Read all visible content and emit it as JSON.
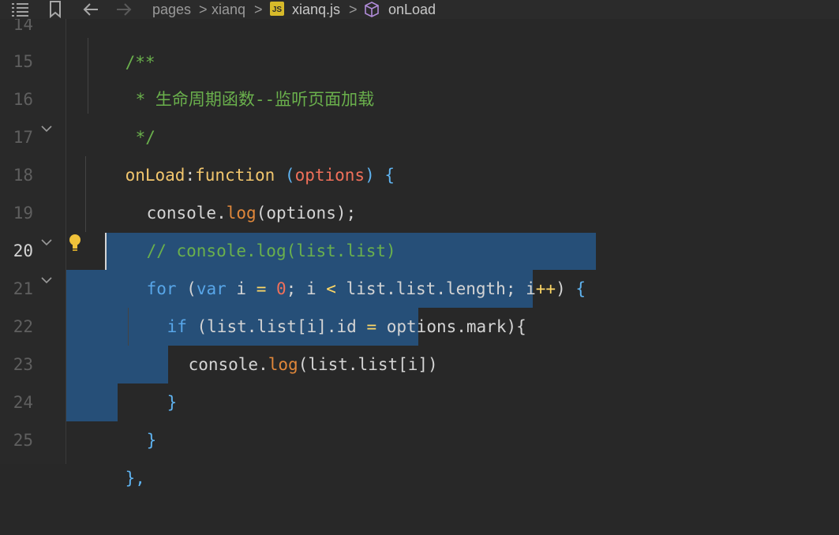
{
  "breadcrumb": {
    "items": [
      "pages",
      "xianq",
      "xianq.js",
      "onLoad"
    ],
    "file_badge": "JS",
    "separator": ">"
  },
  "gutter": {
    "line_numbers": [
      "14",
      "15",
      "16",
      "17",
      "18",
      "19",
      "20",
      "21",
      "22",
      "23",
      "24",
      "25"
    ],
    "active_line": "20"
  },
  "code": {
    "l14": "/**",
    "l15": "* 生命周期函数--监听页面加载",
    "l16": "*/",
    "l17_key": "onLoad",
    "l17_colon": ":",
    "l17_fn": "function",
    "l17_par_open": "(",
    "l17_param": "options",
    "l17_par_close": ")",
    "l17_brace": "{",
    "l18_obj": "console",
    "l18_dot": ".",
    "l18_method": "log",
    "l18_rest": "(options);",
    "l19": "// console.log(list.list)",
    "l20_for": "for",
    "l20_a": " (",
    "l20_var": "var",
    "l20_b": " i ",
    "l20_eq": "=",
    "l20_c": " ",
    "l20_zero": "0",
    "l20_d": "; i ",
    "l20_lt": "<",
    "l20_e": " list.list.length; i",
    "l20_inc": "++",
    "l20_f": ") ",
    "l20_brace": "{",
    "l21_if": "if",
    "l21_a": " (list.list[i].id ",
    "l21_eq": "=",
    "l21_b": " options.mark){",
    "l22_obj": "console",
    "l22_dot": ".",
    "l22_method": "log",
    "l22_rest": "(list.list[i])",
    "l23": "}",
    "l24": "}",
    "l25": "},"
  },
  "colors": {
    "background": "#282828",
    "selection": "#264f78",
    "comment": "#6ab04c",
    "keyword": "#58a6e8",
    "property": "#f2c66d",
    "method": "#e0873a"
  }
}
